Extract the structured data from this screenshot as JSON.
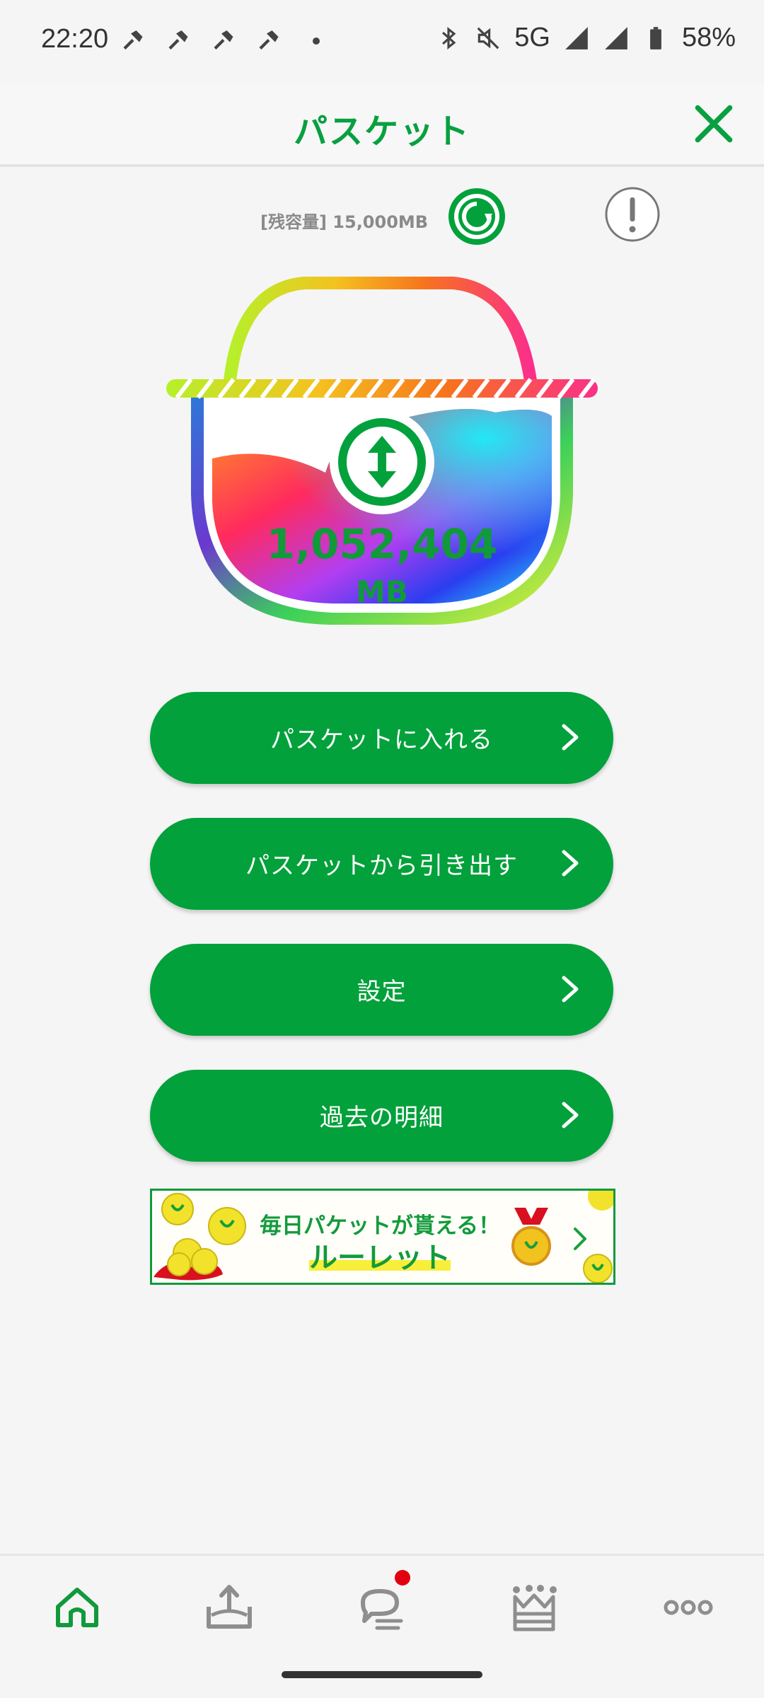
{
  "status_bar": {
    "time": "22:20",
    "network": "5G",
    "battery": "58%"
  },
  "header": {
    "title": "パスケット",
    "close_icon": "close-icon"
  },
  "capacity": {
    "label": "[残容量] 15,000MB"
  },
  "basket": {
    "balance_value": "1,052,404",
    "balance_unit": "MB"
  },
  "menu": {
    "items": [
      {
        "label": "パスケットに入れる"
      },
      {
        "label": "パスケットから引き出す"
      },
      {
        "label": "設定"
      },
      {
        "label": "過去の明細"
      }
    ]
  },
  "banner": {
    "line1": "毎日パケットが貰える！",
    "line2": "ルーレット"
  },
  "bottom_nav": {
    "items": [
      "home-icon",
      "upload-icon",
      "chat-icon",
      "crown-icon",
      "more-icon"
    ],
    "active_color": "#109a3a",
    "inactive_color": "#8e8e8e",
    "badge_color": "#e0000f"
  },
  "colors": {
    "brand_green": "#02a13b",
    "background": "#f5f5f5"
  }
}
